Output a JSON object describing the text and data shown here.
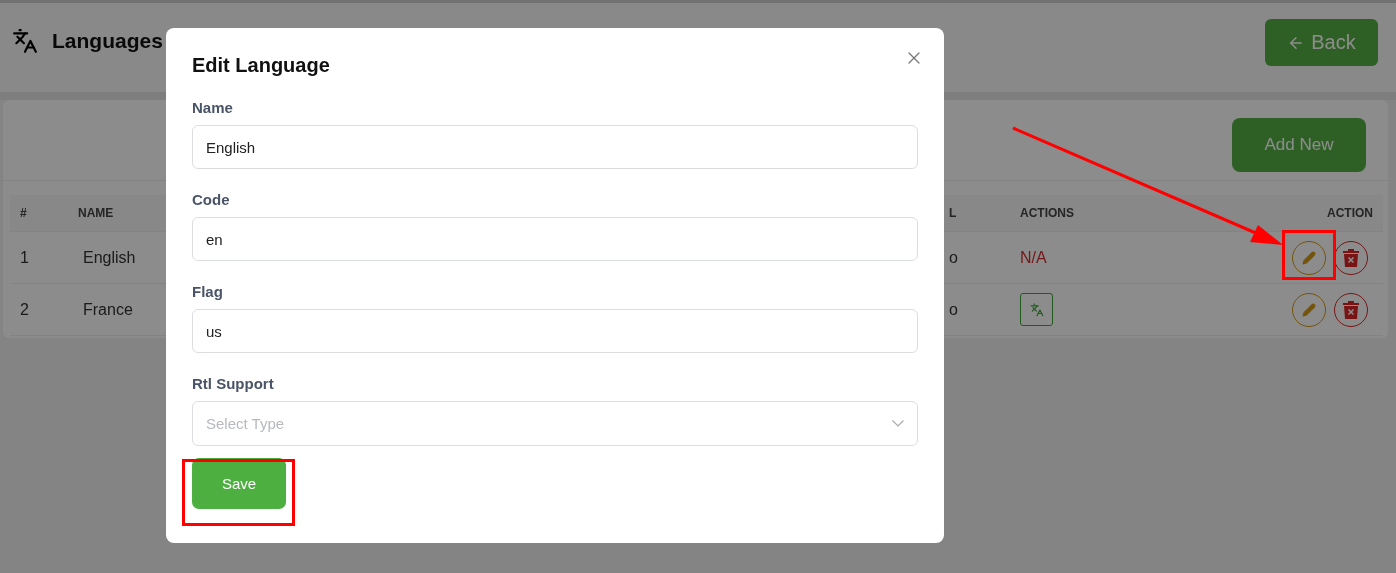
{
  "header": {
    "title": "Languages",
    "back_button": "Back"
  },
  "card": {
    "add_button": "Add New"
  },
  "table": {
    "columns": [
      "#",
      "NAME",
      "L",
      "ACTIONS",
      "ACTION"
    ],
    "rows": [
      {
        "index": "1",
        "name": "English",
        "column_3": "o",
        "actions": {
          "kind": "text",
          "text": "N/A"
        }
      },
      {
        "index": "2",
        "name": "France",
        "column_3": "o",
        "actions": {
          "kind": "translate_button"
        }
      }
    ]
  },
  "modal": {
    "title": "Edit Language",
    "fields": [
      {
        "kind": "input",
        "label": "Name",
        "value": "English"
      },
      {
        "kind": "input",
        "label": "Code",
        "value": "en"
      },
      {
        "kind": "input",
        "label": "Flag",
        "value": "us"
      },
      {
        "kind": "select",
        "label": "Rtl Support",
        "placeholder": "Select Type"
      }
    ],
    "save_button": "Save"
  }
}
